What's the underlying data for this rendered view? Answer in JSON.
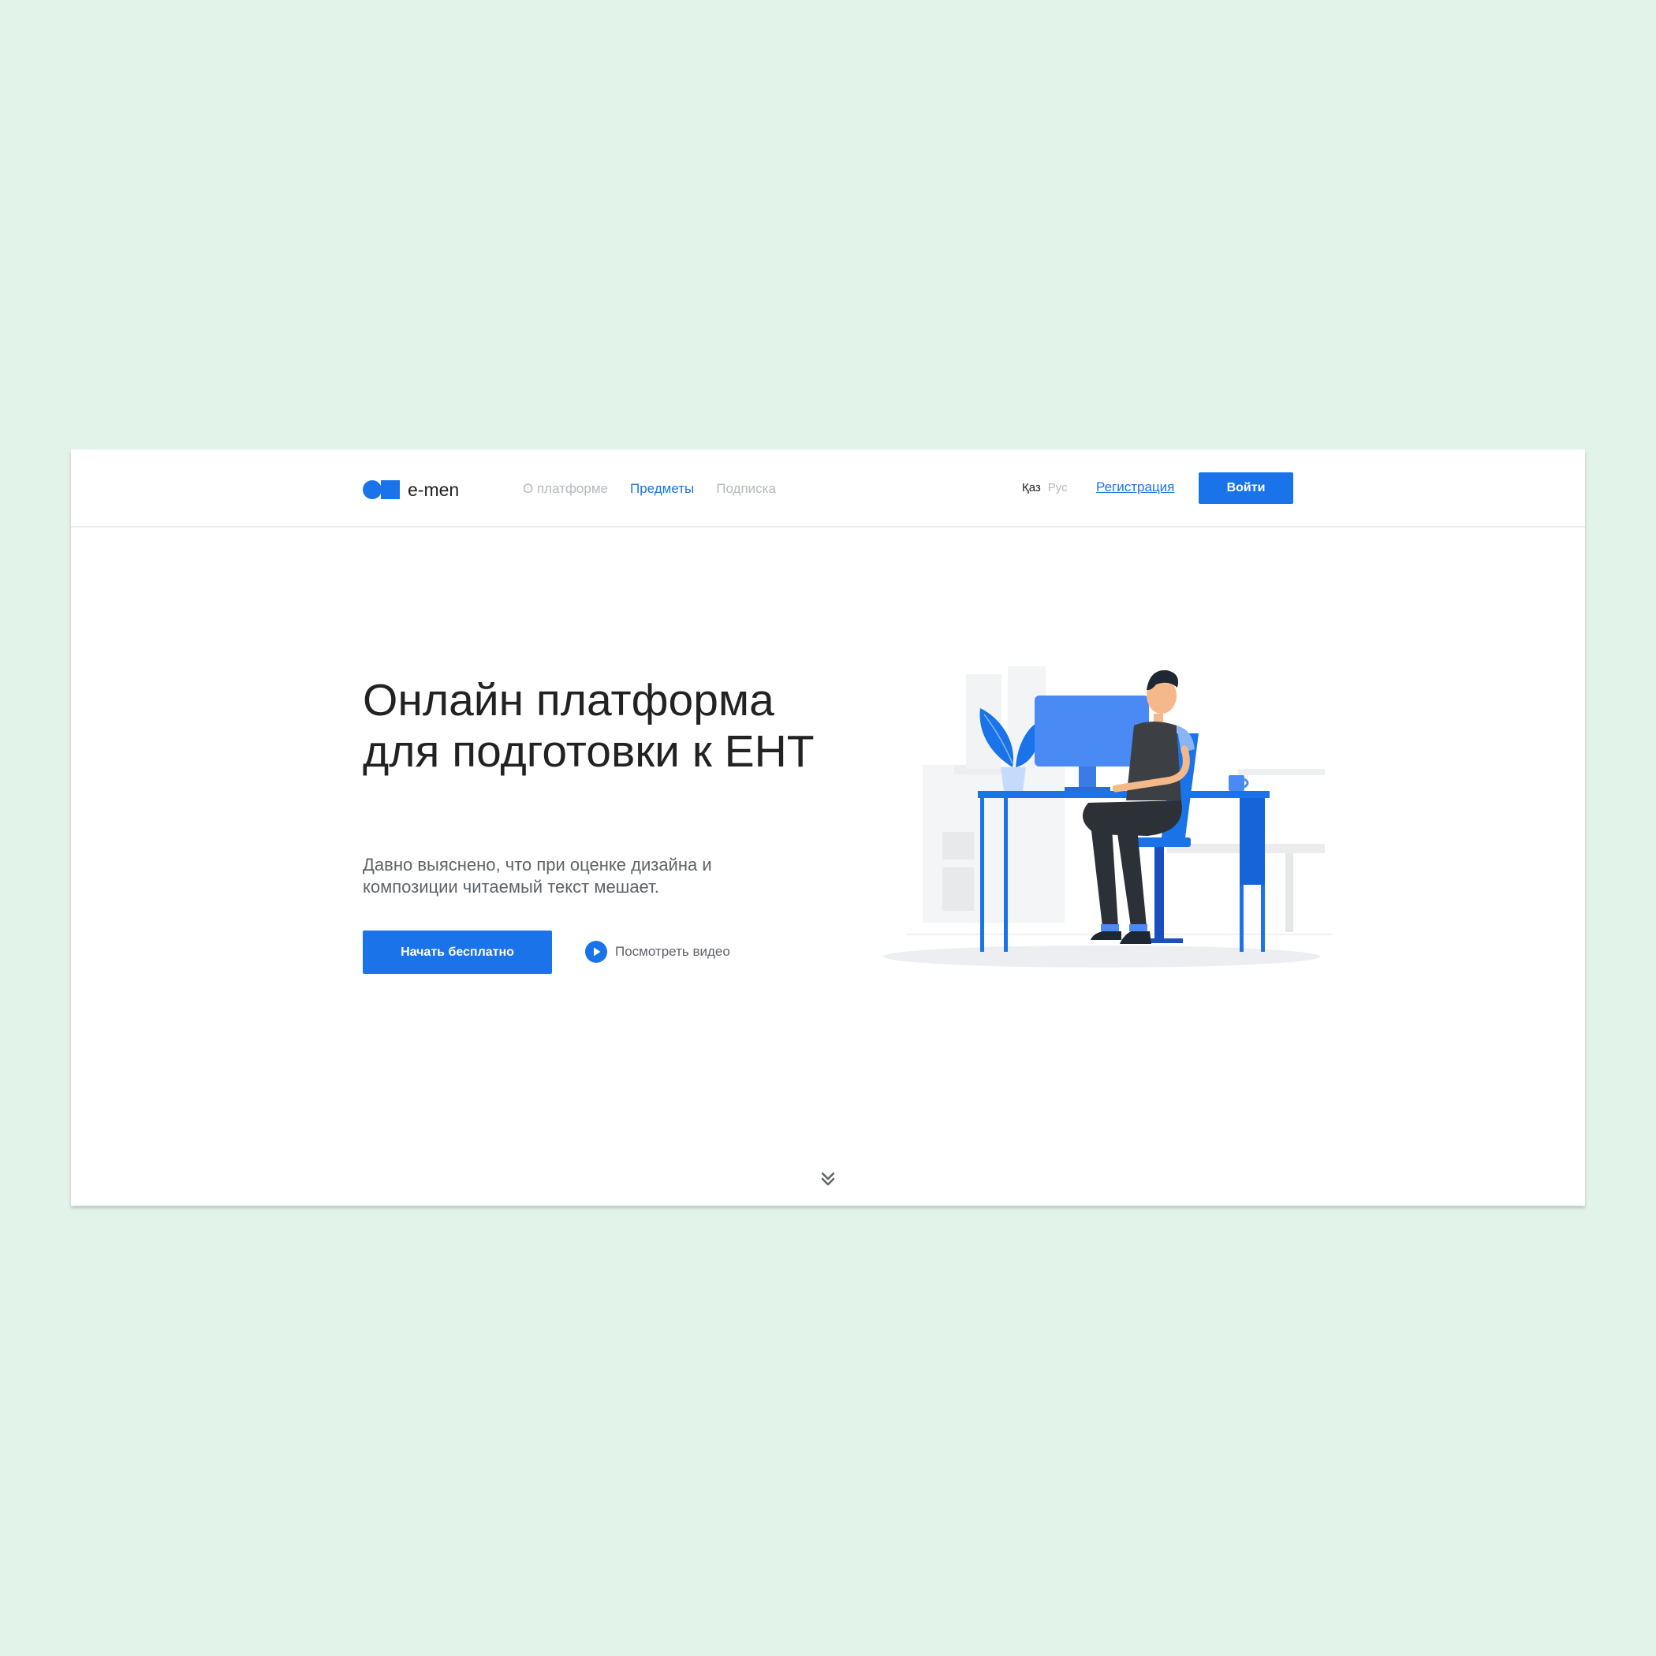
{
  "brand": {
    "name": "e-men"
  },
  "nav": {
    "items": [
      {
        "label": "О платформе"
      },
      {
        "label": "Предметы"
      },
      {
        "label": "Подписка"
      }
    ]
  },
  "lang": {
    "kaz": "Қаз",
    "rus": "Рус"
  },
  "auth": {
    "register": "Регистрация",
    "login": "Войти"
  },
  "hero": {
    "title": "Онлайн платформа для подготовки к ЕНТ",
    "description": "Давно выяснено, что при оценке дизайна и композиции читаемый текст мешает.",
    "cta": "Начать бесплатно",
    "video": "Посмотреть видео"
  },
  "colors": {
    "page_background": "#e2f3e9",
    "accent": "#1a73e8",
    "text_primary": "#222222",
    "text_muted": "#b4b8bd"
  },
  "icons": {
    "logo": "circle-square-logo-icon",
    "play": "play-icon",
    "scroll": "double-chevron-down-icon"
  }
}
